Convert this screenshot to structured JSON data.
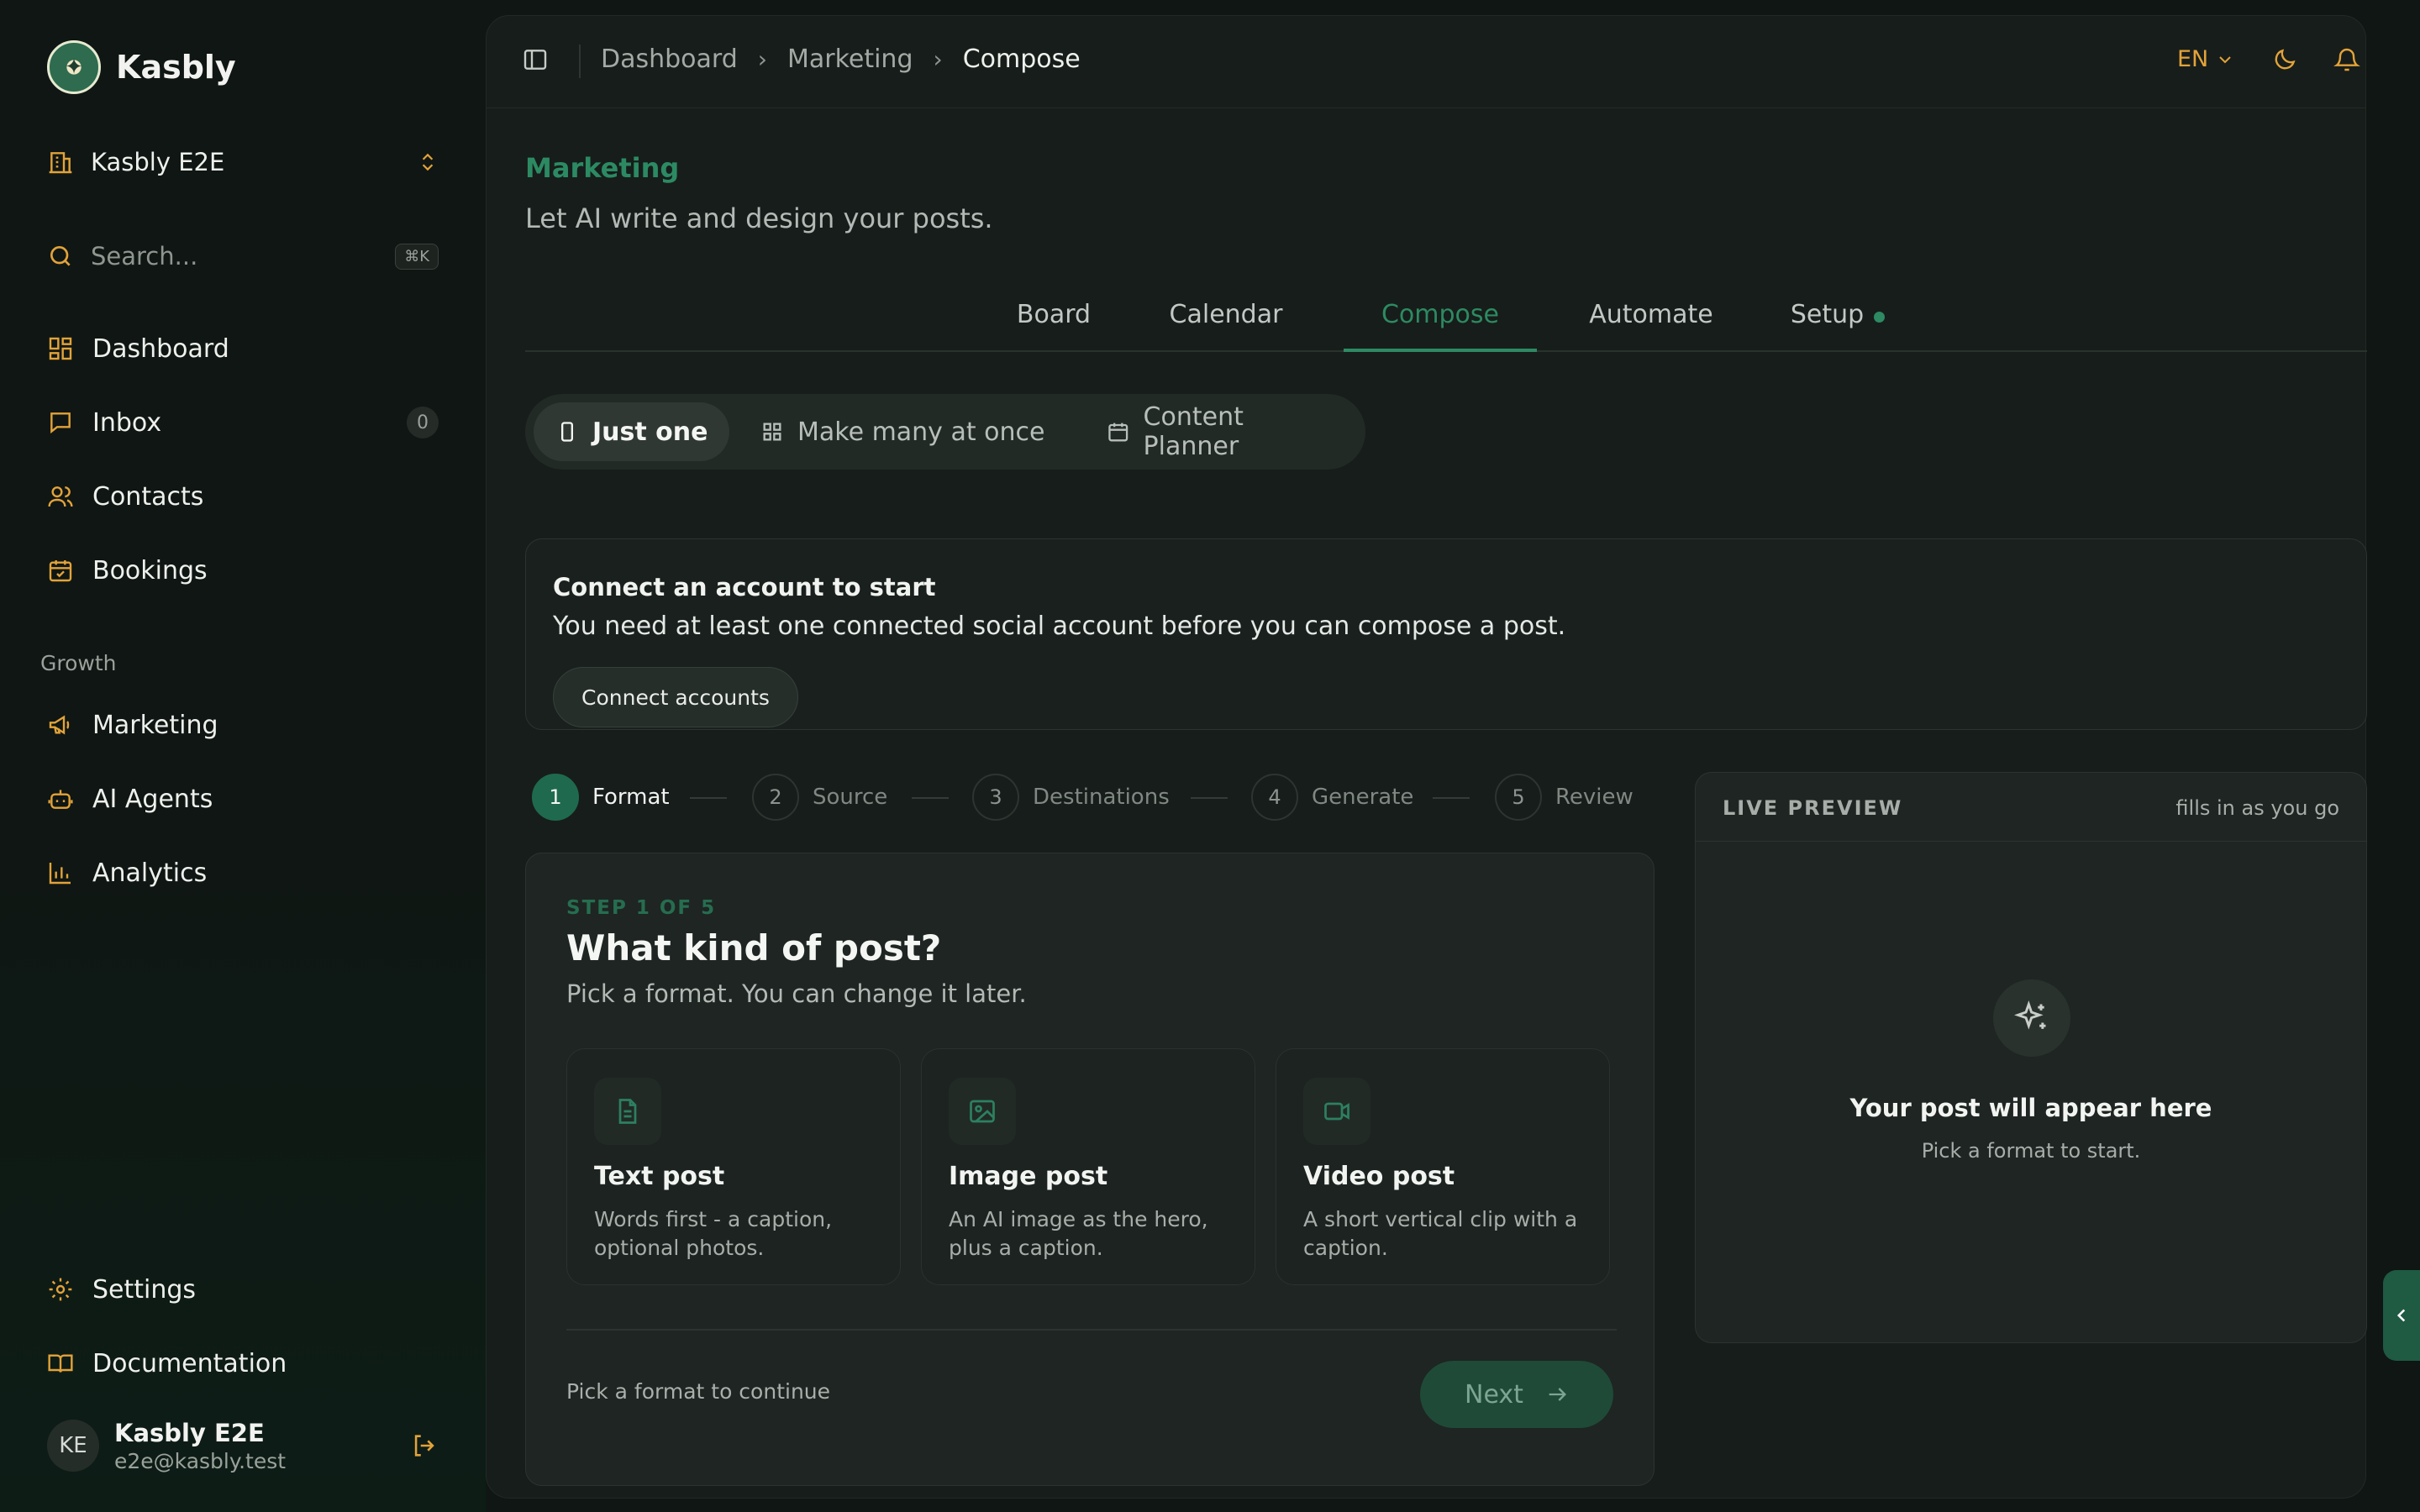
{
  "app": {
    "name": "Kasbly"
  },
  "sidebar": {
    "workspace": "Kasbly E2E",
    "search": {
      "placeholder": "Search...",
      "shortcut": "⌘K"
    },
    "items": [
      {
        "label": "Dashboard",
        "icon": "dashboard-icon"
      },
      {
        "label": "Inbox",
        "icon": "inbox-icon",
        "badge": "0"
      },
      {
        "label": "Contacts",
        "icon": "contacts-icon"
      },
      {
        "label": "Bookings",
        "icon": "calendar-check-icon"
      }
    ],
    "section": "Growth",
    "growth_items": [
      {
        "label": "Marketing",
        "icon": "megaphone-icon"
      },
      {
        "label": "AI Agents",
        "icon": "bot-icon"
      },
      {
        "label": "Analytics",
        "icon": "bar-chart-icon"
      }
    ],
    "bottom_items": [
      {
        "label": "Settings",
        "icon": "gear-icon"
      },
      {
        "label": "Documentation",
        "icon": "book-icon"
      }
    ],
    "user": {
      "initials": "KE",
      "name": "Kasbly E2E",
      "email": "e2e@kasbly.test"
    }
  },
  "header": {
    "breadcrumbs": [
      "Dashboard",
      "Marketing",
      "Compose"
    ],
    "language": "EN"
  },
  "page": {
    "title": "Marketing",
    "subtitle": "Let AI write and design your posts.",
    "tabs": [
      "Board",
      "Calendar",
      "Compose",
      "Automate",
      "Setup"
    ],
    "active_tab": "Compose",
    "modes": [
      "Just one",
      "Make many at once",
      "Content Planner"
    ],
    "active_mode": "Just one"
  },
  "alert": {
    "title": "Connect an account to start",
    "body": "You need at least one connected social account before you can compose a post.",
    "button": "Connect accounts"
  },
  "stepper": {
    "steps": [
      {
        "num": "1",
        "label": "Format"
      },
      {
        "num": "2",
        "label": "Source"
      },
      {
        "num": "3",
        "label": "Destinations"
      },
      {
        "num": "4",
        "label": "Generate"
      },
      {
        "num": "5",
        "label": "Review"
      }
    ],
    "active": 1
  },
  "format_card": {
    "step_caption": "STEP 1 OF 5",
    "title": "What kind of post?",
    "subtitle": "Pick a format. You can change it later.",
    "options": [
      {
        "title": "Text post",
        "desc": "Words first - a caption, optional photos.",
        "icon": "document-icon"
      },
      {
        "title": "Image post",
        "desc": "An AI image as the hero, plus a caption.",
        "icon": "image-icon"
      },
      {
        "title": "Video post",
        "desc": "A short vertical clip with a caption.",
        "icon": "video-icon"
      }
    ],
    "hint": "Pick a format to continue",
    "next": "Next"
  },
  "preview": {
    "label": "LIVE PREVIEW",
    "note": "fills in as you go",
    "title": "Your post will appear here",
    "subtitle": "Pick a format to start."
  },
  "colors": {
    "accent": "#2d8a63",
    "icon": "#e2a33a",
    "background": "#171d1a"
  }
}
